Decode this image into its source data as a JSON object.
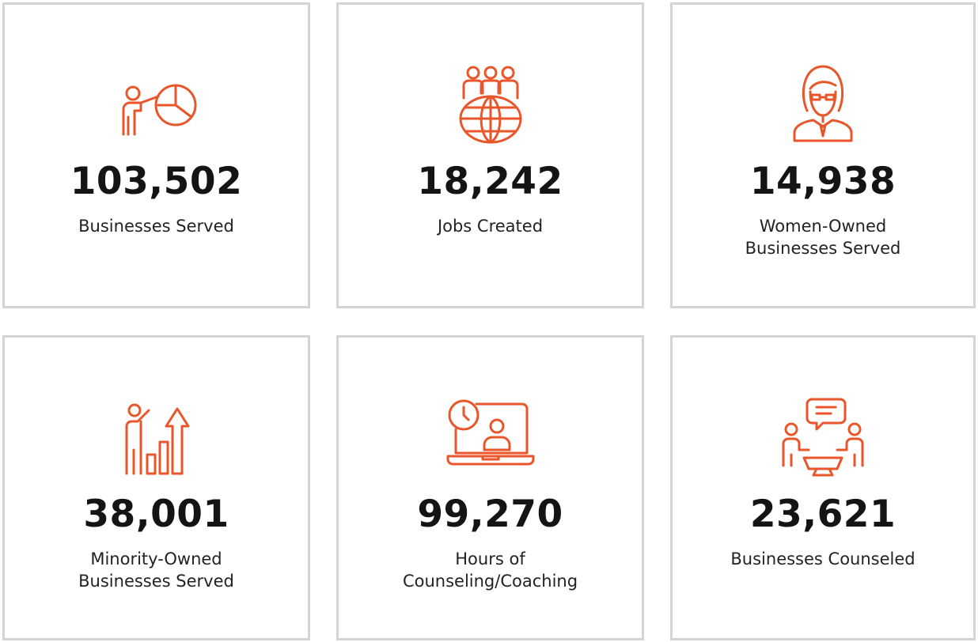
{
  "accent_color": "#e8562a",
  "stats": [
    {
      "value": "103,502",
      "label": "Businesses Served",
      "icon": "presentation-pie-chart-icon"
    },
    {
      "value": "18,242",
      "label": "Jobs Created",
      "icon": "global-team-icon"
    },
    {
      "value": "14,938",
      "label": "Women-Owned\nBusinesses Served",
      "icon": "businesswoman-icon"
    },
    {
      "value": "38,001",
      "label": "Minority-Owned\nBusinesses Served",
      "icon": "growth-chart-presenter-icon"
    },
    {
      "value": "99,270",
      "label": "Hours of\nCounseling/Coaching",
      "icon": "laptop-clock-coaching-icon"
    },
    {
      "value": "23,621",
      "label": "Businesses Counseled",
      "icon": "meeting-chat-icon"
    }
  ]
}
